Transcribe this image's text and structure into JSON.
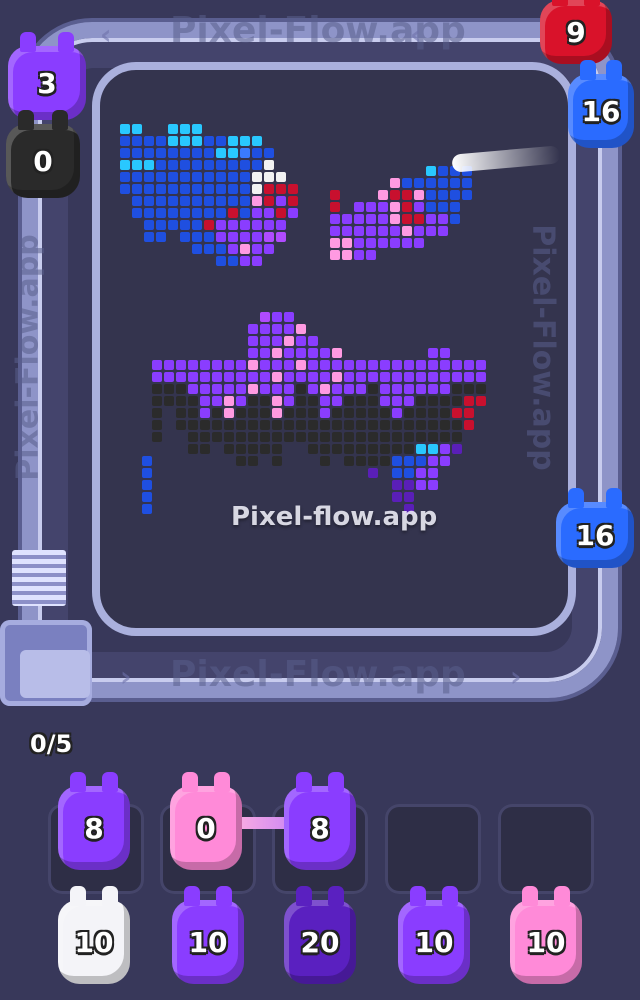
{
  "watermark": "Pixel-flow.app",
  "lane_text_top": "Pixel-Flow.app",
  "lane_text_bottom": "Pixel-Flow.app",
  "lane_text_right": "Pixel-Flow.app",
  "lane_text_left": "Pixel-Flow.app",
  "queue_counter": "0/5",
  "colors": {
    "purple": "#8a3dff",
    "pink": "#ff8ad8",
    "white": "#f4f4f8",
    "blue": "#2a6bff",
    "red": "#d9122a",
    "black": "#2a2a2a",
    "dark_purple": "#5a20c0"
  },
  "track_shooters": [
    {
      "name": "purple-shooter",
      "color": "purple",
      "count": "3"
    },
    {
      "name": "black-shooter",
      "color": "black",
      "count": "0"
    },
    {
      "name": "red-shooter",
      "color": "red",
      "count": "9"
    },
    {
      "name": "blue-shooter-top",
      "color": "blue",
      "count": "16"
    },
    {
      "name": "blue-shooter-right",
      "color": "blue",
      "count": "16"
    }
  ],
  "active_slots": [
    {
      "color": "purple",
      "count": "8"
    },
    {
      "color": "pink",
      "count": "0"
    },
    {
      "color": "purple",
      "count": "8"
    },
    {
      "color": "",
      "count": ""
    },
    {
      "color": "",
      "count": ""
    }
  ],
  "reserve": [
    {
      "color": "white",
      "count": "10"
    },
    {
      "color": "purple",
      "count": "10"
    },
    {
      "color": "dark_purple",
      "count": "20"
    },
    {
      "color": "purple",
      "count": "10"
    },
    {
      "color": "pink",
      "count": "10"
    }
  ]
}
